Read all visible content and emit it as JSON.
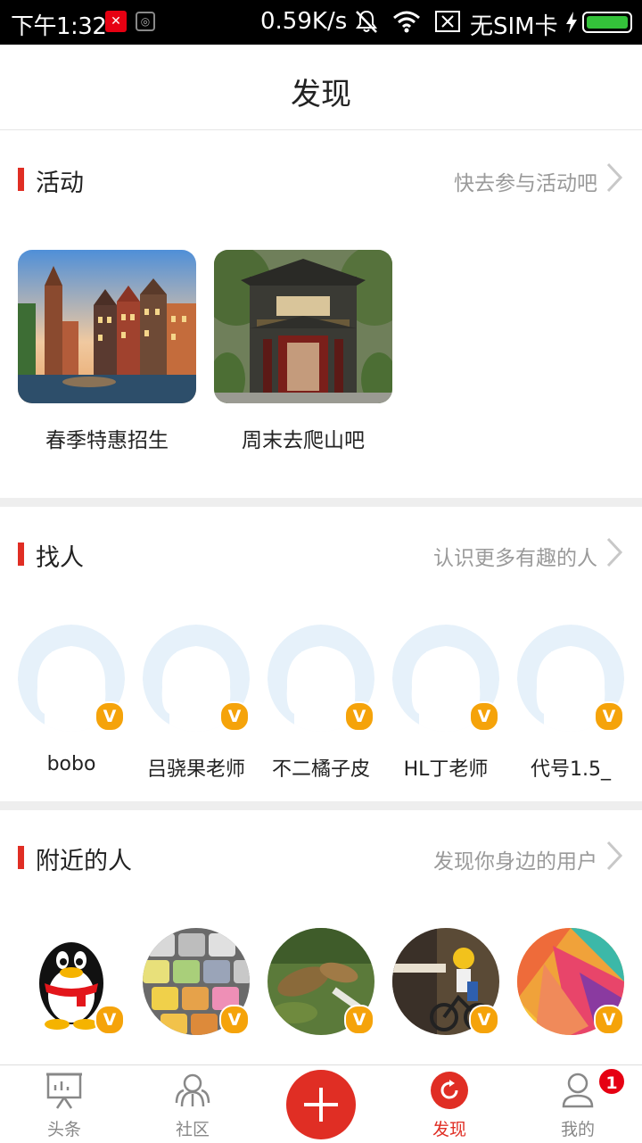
{
  "status_bar": {
    "time": "下午1:32",
    "speed": "0.59K/s",
    "sim": "无SIM卡",
    "icons": [
      "app-x-icon",
      "app-badge-icon",
      "mute-icon",
      "wifi-icon",
      "no-sim-icon",
      "charging-icon",
      "battery-icon"
    ],
    "battery_level": 1.0
  },
  "header": {
    "title": "发现"
  },
  "activity": {
    "title": "活动",
    "link": "快去参与活动吧",
    "items": [
      {
        "label": "春季特惠招生"
      },
      {
        "label": "周末去爬山吧"
      }
    ]
  },
  "find_people": {
    "title": "找人",
    "link": "认识更多有趣的人",
    "people": [
      {
        "name": "bobo",
        "badge": "V"
      },
      {
        "name": "吕骁果老师",
        "badge": "V"
      },
      {
        "name": "不二橘子皮",
        "badge": "V"
      },
      {
        "name": "HL丁老师",
        "badge": "V"
      },
      {
        "name": "代号1.5_",
        "badge": "V"
      }
    ]
  },
  "nearby": {
    "title": "附近的人",
    "link": "发现你身边的用户",
    "badge": "V"
  },
  "bottom_nav": {
    "items": [
      {
        "label": "头条",
        "icon": "presentation-icon"
      },
      {
        "label": "社区",
        "icon": "community-icon"
      },
      {
        "label": "",
        "icon": "plus-icon"
      },
      {
        "label": "发现",
        "icon": "discover-icon"
      },
      {
        "label": "我的",
        "icon": "profile-icon"
      }
    ],
    "badge_count": "1"
  },
  "colors": {
    "accent": "#e02e24",
    "badge": "#f5a30a",
    "link": "#9a9a9a"
  }
}
